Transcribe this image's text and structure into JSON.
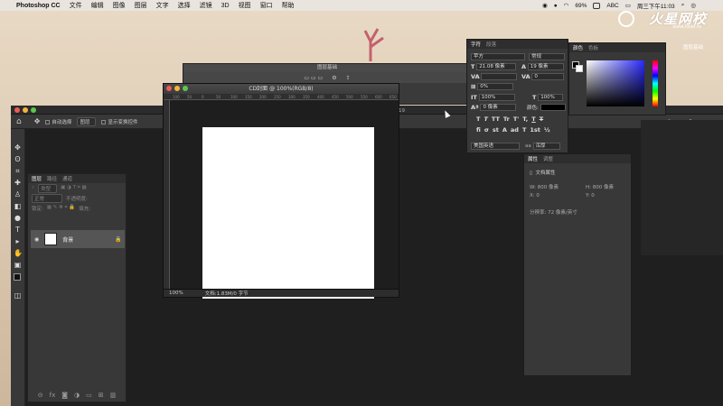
{
  "menubar": {
    "app": "Photoshop CC",
    "items": [
      "文件",
      "编辑",
      "图像",
      "图层",
      "文字",
      "选择",
      "滤镜",
      "3D",
      "视图",
      "窗口",
      "帮助"
    ],
    "battery": "69%",
    "input": "ABC",
    "clock": "周三下午11:03"
  },
  "watermark": {
    "brand": "火星网校",
    "site": "www.hxsd.tv",
    "desktop_label": "图层基础"
  },
  "options_bar": {
    "auto_select": "自动选择",
    "target": "图层",
    "show_transform": "显示变换控件"
  },
  "layers_panel": {
    "tabs": [
      "图层",
      "路径",
      "通道"
    ],
    "filter": "类型",
    "blend_mode": "正常",
    "opacity_label": "不透明度:",
    "lock_label": "锁定:",
    "fill_label": "填充:",
    "layer_name": "背景"
  },
  "bg_doc": {
    "title": "图层基础"
  },
  "doc": {
    "title": "CD封面 @ 100%(RGB/8)",
    "zoom": "100%",
    "info": "文档:1.83M/0 字节",
    "ruler_ticks": [
      "100",
      "50",
      "0",
      "50",
      "100",
      "150",
      "200",
      "250",
      "300",
      "350",
      "400",
      "450",
      "500",
      "550",
      "600",
      "650"
    ]
  },
  "char_panel": {
    "tabs": [
      "字符",
      "段落"
    ],
    "font": "苹方",
    "style": "常规",
    "size": "21.08 像素",
    "leading": "19 像素",
    "kerning": "",
    "tracking": "0",
    "tsume": "0%",
    "vscale": "100%",
    "hscale": "100%",
    "baseline": "0 像素",
    "color_label": "颜色:",
    "language": "美国英语",
    "aa_label": "aa",
    "aa": "浑厚",
    "glyphs": [
      "T",
      "T",
      "TT",
      "Tr",
      "T'",
      "T,",
      "T",
      "T"
    ],
    "glyphs2": [
      "fi",
      "σ",
      "st",
      "A",
      "ad",
      "T",
      "1st",
      "½"
    ]
  },
  "color_panel": {
    "tabs": [
      "颜色",
      "色板"
    ]
  },
  "props_panel": {
    "tabs": [
      "属性",
      "调整"
    ],
    "section": "文档属性",
    "w": "W: 800 像素",
    "h": "H: 800 像素",
    "x": "X: 0",
    "y": "Y: 0",
    "resolution": "分辨率: 72 像素/英寸"
  },
  "status_fragment": "19"
}
